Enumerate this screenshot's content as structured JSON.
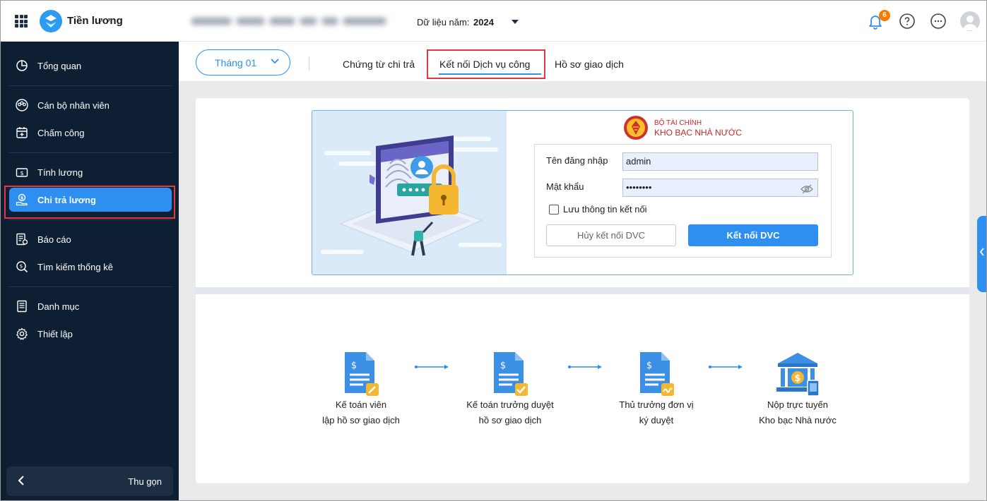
{
  "app": {
    "name": "Tiền lương"
  },
  "header": {
    "year_label": "Dữ liệu năm:",
    "year_value": "2024",
    "notification_count": "6"
  },
  "sidebar": {
    "items": [
      {
        "label": "Tổng quan",
        "icon": "pie-chart-icon"
      },
      {
        "label": "Cán bộ nhân viên",
        "icon": "users-icon"
      },
      {
        "label": "Chấm công",
        "icon": "calendar-icon"
      },
      {
        "label": "Tính lương",
        "icon": "salary-calc-icon"
      },
      {
        "label": "Chi trả lương",
        "icon": "payment-hand-icon",
        "active": true
      },
      {
        "label": "Báo cáo",
        "icon": "report-icon"
      },
      {
        "label": "Tìm kiếm thống kê",
        "icon": "search-stats-icon"
      },
      {
        "label": "Danh mục",
        "icon": "catalog-icon"
      },
      {
        "label": "Thiết lập",
        "icon": "gear-icon"
      }
    ],
    "collapse_label": "Thu gọn"
  },
  "subheader": {
    "month": "Tháng 01",
    "tabs": [
      {
        "label": "Chứng từ chi trả"
      },
      {
        "label": "Kết nối Dịch vụ công",
        "active": true
      },
      {
        "label": "Hồ sơ giao dịch"
      }
    ]
  },
  "login": {
    "org_top": "BỘ TÀI CHÍNH",
    "org_name": "KHO BẠC NHÀ NƯỚC",
    "username_label": "Tên đăng nhập",
    "username_value": "admin",
    "password_label": "Mật khẩu",
    "password_value": "••••••••",
    "remember_label": "Lưu thông tin kết nối",
    "cancel_button": "Hủy kết nối DVC",
    "connect_button": "Kết nối DVC"
  },
  "workflow": {
    "steps": [
      {
        "line1": "Kế toán viên",
        "line2": "lập hồ sơ giao dịch"
      },
      {
        "line1": "Kế toán trưởng duyệt",
        "line2": "hồ sơ giao dịch"
      },
      {
        "line1": "Thủ trưởng đơn vị",
        "line2": "ký duyệt"
      },
      {
        "line1": "Nộp trực tuyến",
        "line2": "Kho bạc Nhà nước"
      }
    ]
  },
  "colors": {
    "primary": "#2d8ff0",
    "sidebar_bg": "#0e1e33",
    "highlight": "#e0393e",
    "badge": "#f57c00"
  }
}
